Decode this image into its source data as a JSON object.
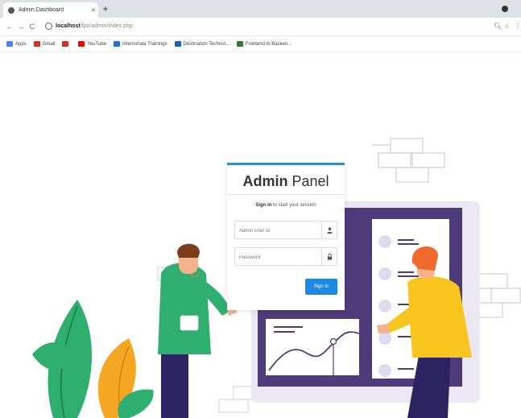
{
  "browser": {
    "tab_title": "Admin Dashboard",
    "tab_close": "×",
    "new_tab": "+",
    "url_host": "localhost",
    "url_path": "/fpo/admin/index.php"
  },
  "bookmarks": [
    {
      "label": "Apps",
      "color": "#4285f4"
    },
    {
      "label": "Gmail",
      "color": "#d93025"
    },
    {
      "label": "",
      "color": "#d93025"
    },
    {
      "label": "YouTube",
      "color": "#ff0000"
    },
    {
      "label": "Internshala Trainings",
      "color": "#1a73e8"
    },
    {
      "label": "Destination Technol...",
      "color": "#1565c0"
    },
    {
      "label": "Frontend to Backen...",
      "color": "#2e7d32"
    }
  ],
  "login": {
    "title_bold": "Admin",
    "title_rest": " Panel",
    "msg_bold": "Sign in",
    "msg_rest": " to start your session",
    "userid_placeholder": "Admin User Id",
    "password_placeholder": "Password",
    "signin_label": "Sign In"
  },
  "colors": {
    "accent": "#3c8dbc",
    "button": "#1e88e5",
    "panel_purple": "#4d3b7a",
    "leaf_green": "#2eaf6f",
    "leaf_orange": "#f5a623",
    "shirt_yellow": "#f7c51d"
  }
}
